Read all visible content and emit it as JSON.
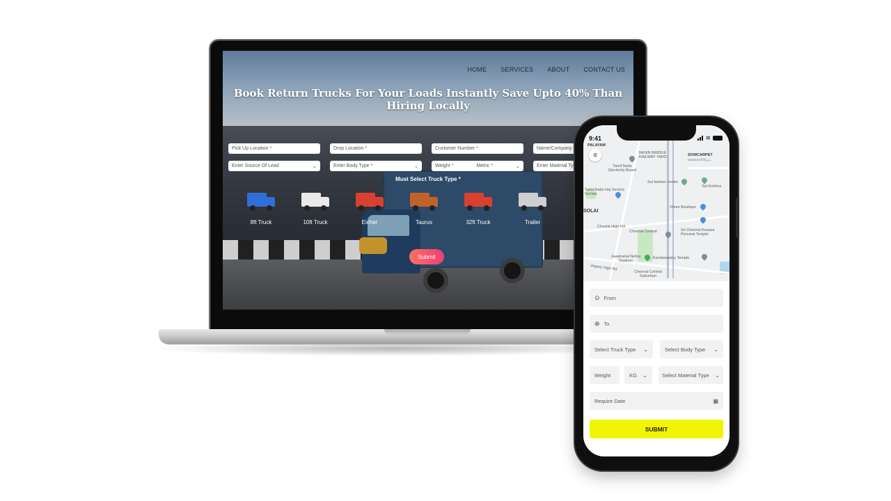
{
  "desktop": {
    "nav": [
      "HOME",
      "SERVICES",
      "ABOUT",
      "CONTACT US"
    ],
    "hero_title": "Book Return Trucks For Your Loads Instantly Save Upto 40% Than Hiring Locally",
    "form": {
      "row1": [
        "Pick Up Location *",
        "Drop Location *",
        "Customer Number *",
        "Name/Company *"
      ],
      "row2": [
        "Enter Source Of Lead",
        "Enter Body Type *",
        "Weight *",
        "Enter Material Type"
      ],
      "metric": "Metric *"
    },
    "truck_heading": "Must Select Truck Type *",
    "truck_types": [
      {
        "label": "8ft Truck",
        "color": "#2f6fd6"
      },
      {
        "label": "10ft Truck",
        "color": "#e9e9e9"
      },
      {
        "label": "Eicher",
        "color": "#d8412f"
      },
      {
        "label": "Taurus",
        "color": "#c2622b"
      },
      {
        "label": "32ft Truck",
        "color": "#d8412f"
      },
      {
        "label": "Trailer",
        "color": "#cfcfcf"
      }
    ],
    "submit": "Submit"
  },
  "mobile": {
    "time": "9:41",
    "map_labels": {
      "tamil_nadu_board": "Tamil Nadu Electricity Board",
      "sowcarpet": "SOWCARPET",
      "sowcarpet_ta": "சௌகார்பேட்",
      "basin_bridge": "BASIN BRIDGE RAILWAY YARD",
      "sai_krishna": "Sai Krishna",
      "service_society": "Tamil Nadu Haj Service Society",
      "shree_boutique": "Shree Boutique",
      "solai": "SOLAI",
      "chennai_central": "Chennai Central",
      "chennai_keshava": "Sri Chennai Kesava Perumal Temple",
      "jawaharlal": "Jawaharlal Nehru Stadium",
      "kandaswamy": "Kandaswamy Temple",
      "central_suburban": "Chennai Central Suburban",
      "vepery": "Vepery High Rd",
      "choolai": "Choolai High Rd",
      "salt_cotaurs": "Sai fashion center",
      "palayam": "PALAYAM"
    },
    "from": "From",
    "to": "To",
    "truck_type": "Select Truck Type",
    "body_type": "Select Body Type",
    "weight": "Weight",
    "unit": "KG",
    "material": "Select Material Type",
    "date": "Require Date",
    "submit": "SUBMIT"
  }
}
